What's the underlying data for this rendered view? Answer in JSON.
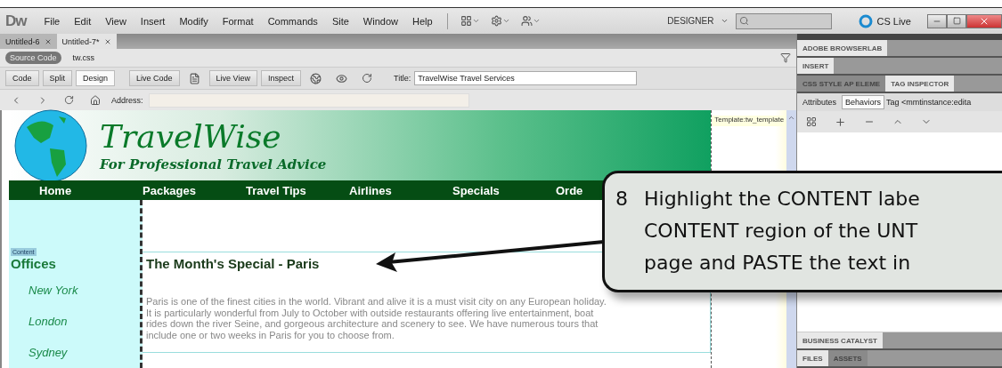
{
  "menu_bar": {
    "logo": "Dw",
    "items": [
      "File",
      "Edit",
      "View",
      "Insert",
      "Modify",
      "Format",
      "Commands",
      "Site",
      "Window",
      "Help"
    ],
    "workspace": "DESIGNER",
    "cs_live": "CS Live"
  },
  "document_tabs": [
    {
      "label": "Untitled-6",
      "selected": false
    },
    {
      "label": "Untitled-7*",
      "selected": true
    }
  ],
  "related_files": [
    {
      "label": "Source Code",
      "selected": true
    },
    {
      "label": "tw.css",
      "selected": false
    }
  ],
  "view_buttons": [
    {
      "label": "Code",
      "selected": false
    },
    {
      "label": "Split",
      "selected": false
    },
    {
      "label": "Design",
      "selected": true
    }
  ],
  "toolbar_buttons": [
    "Live Code",
    "Live View",
    "Inspect"
  ],
  "title_field": {
    "label": "Title:",
    "value": "TravelWise Travel Services"
  },
  "address_bar": {
    "label": "Address:"
  },
  "template_label": "Template:tw_template",
  "page": {
    "site_title": "TravelWise",
    "tagline": "For Professional Travel Advice",
    "nav": [
      "Home",
      "Packages",
      "Travel Tips",
      "Airlines",
      "Specials",
      "Orde"
    ],
    "region_tag": "Content",
    "sidebar_heading": "Offices",
    "offices": [
      "New York",
      "London",
      "Sydney"
    ],
    "heading": "The Month's Special - Paris",
    "paragraph": "Paris is one of the finest cities in the world.  Vibrant and alive it is a must visit city on any European holiday. It is particularly wonderful from July to October with outside restaurants offering live entertainment, boat rides down the river Seine, and gorgeous architecture and scenery to see. We have numerous tours that include one or two weeks in Paris for you to choose from."
  },
  "panels": {
    "browserlab": "ADOBE BROWSERLAB",
    "insert": "INSERT",
    "panel_tabs": [
      {
        "label": "CSS STYLE AP ELEME",
        "selected": false
      },
      {
        "label": "TAG INSPECTOR",
        "selected": true
      }
    ],
    "inspector_tabs": [
      {
        "label": "Attributes",
        "selected": false
      },
      {
        "label": "Behaviors",
        "selected": true
      }
    ],
    "tag_label": "Tag <mmtinstance:edita",
    "business_catalyst": "BUSINESS CATALYST",
    "bottom_tabs": [
      {
        "label": "FILES",
        "selected": true
      },
      {
        "label": "ASSETS",
        "selected": false
      }
    ]
  },
  "callout": {
    "number": "8",
    "lines": [
      "Highlight the CONTENT labe",
      "CONTENT region of the UNT",
      "page and PASTE the text in"
    ]
  }
}
